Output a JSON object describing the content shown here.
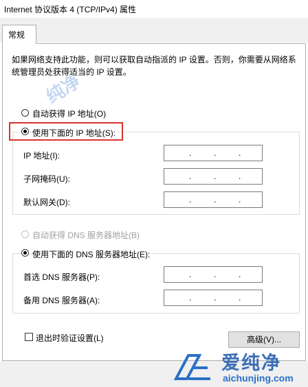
{
  "window": {
    "title": "Internet 协议版本 4 (TCP/IPv4) 属性"
  },
  "tabs": [
    {
      "label": "常规"
    }
  ],
  "general": {
    "description": "如果网络支持此功能，则可以获取自动指派的 IP 设置。否则，你需要从网络系统管理员处获得适当的 IP 设置。",
    "auto_ip_label": "自动获得 IP 地址(O)",
    "manual_ip_label": "使用下面的 IP 地址(S):",
    "ip_address_label": "IP 地址(I):",
    "subnet_mask_label": "子网掩码(U):",
    "default_gateway_label": "默认网关(D):",
    "auto_dns_label": "自动获得 DNS 服务器地址(B)",
    "manual_dns_label": "使用下面的 DNS 服务器地址(E):",
    "preferred_dns_label": "首选 DNS 服务器(P):",
    "alternate_dns_label": "备用 DNS 服务器(A):",
    "validate_label": "退出时验证设置(L)",
    "advanced_button": "高级(V)...",
    "ip_separator": "."
  },
  "watermark": {
    "brand": "爱纯净",
    "url": "aichunjing.com",
    "faint": "纯净"
  },
  "colors": {
    "highlight": "#d6342b",
    "watermark": "#3c6fb6"
  }
}
